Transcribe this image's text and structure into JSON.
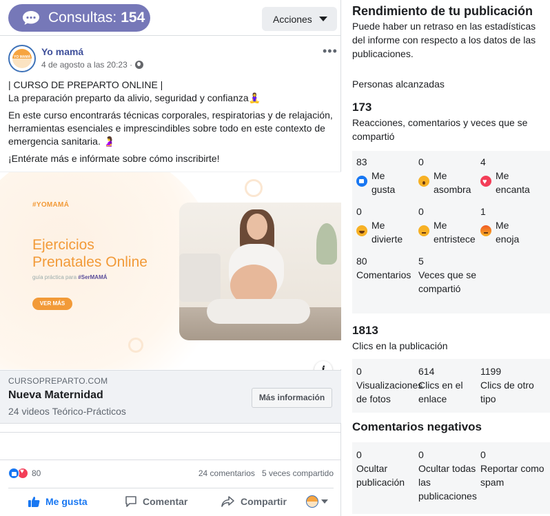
{
  "topbar": {
    "consultas_label": "Consultas:",
    "consultas_count": "154",
    "acciones_label": "Acciones"
  },
  "post": {
    "page_name": "Yo mamá",
    "avatar_text": "YO MAMÁ",
    "date": "4 de agosto a las 20:23 ·",
    "text": [
      "| CURSO DE PREPARTO ONLINE |",
      "La preparación preparto da alivio, seguridad y confianza🧘‍♀️",
      "En este curso encontrarás técnicas corporales, respiratorias y de relajación, herramientas esenciales e imprescindibles sobre todo en este contexto de emergencia sanitaria. 🤰",
      "¡Entérate más e infórmate sobre cómo inscribirte!"
    ],
    "image": {
      "tag": "#YOMAMÁ",
      "title_line1": "Ejercicios",
      "title_line2": "Prenatales Online",
      "subtitle_prefix": "guía práctica para",
      "subtitle_hashtag": "#SerMAMÁ",
      "button": "VER MÁS"
    },
    "link": {
      "domain": "CURSOPREPARTO.COM",
      "title": "Nueva Maternidad",
      "description": "24 videos Teórico-Prácticos",
      "button": "Más información"
    },
    "reactions_count": "80",
    "comments_count": "24 comentarios",
    "shares_count": "5 veces compartido",
    "actions": {
      "like": "Me gusta",
      "comment": "Comentar",
      "share": "Compartir"
    }
  },
  "insights": {
    "title": "Rendimiento de tu publicación",
    "note": "Puede haber un retraso en las estadísticas del informe con respecto a los datos de las publicaciones.",
    "reach_label": "Personas alcanzadas",
    "engagement_value": "173",
    "engagement_label": "Reacciones, comentarios y veces que se compartió",
    "reactions": [
      {
        "value": "83",
        "label": "Me gusta",
        "icon": "like-icon"
      },
      {
        "value": "0",
        "label": "Me asombra",
        "icon": "wow-icon"
      },
      {
        "value": "4",
        "label": "Me encanta",
        "icon": "love-icon"
      },
      {
        "value": "0",
        "label": "Me divierte",
        "icon": "haha-icon"
      },
      {
        "value": "0",
        "label": "Me entristece",
        "icon": "sad-icon"
      },
      {
        "value": "1",
        "label": "Me enoja",
        "icon": "angry-icon"
      }
    ],
    "comments": {
      "value": "80",
      "label": "Comentarios"
    },
    "shares": {
      "value": "5",
      "label": "Veces que se compartió"
    },
    "clicks_value": "1813",
    "clicks_label": "Clics en la publicación",
    "clicks": [
      {
        "value": "0",
        "label": "Visualizaciones de fotos"
      },
      {
        "value": "614",
        "label": "Clics en el enlace"
      },
      {
        "value": "1199",
        "label": "Clics de otro tipo"
      }
    ],
    "negative_title": "Comentarios negativos",
    "negative": [
      {
        "value": "0",
        "label": "Ocultar publicación"
      },
      {
        "value": "0",
        "label": "Ocultar todas las publicaciones"
      },
      {
        "value": "0",
        "label": "Reportar como spam"
      }
    ]
  },
  "colors": {
    "accent_purple": "#7678b8",
    "brand_orange": "#f29a38",
    "facebook_blue": "#1877f2"
  }
}
